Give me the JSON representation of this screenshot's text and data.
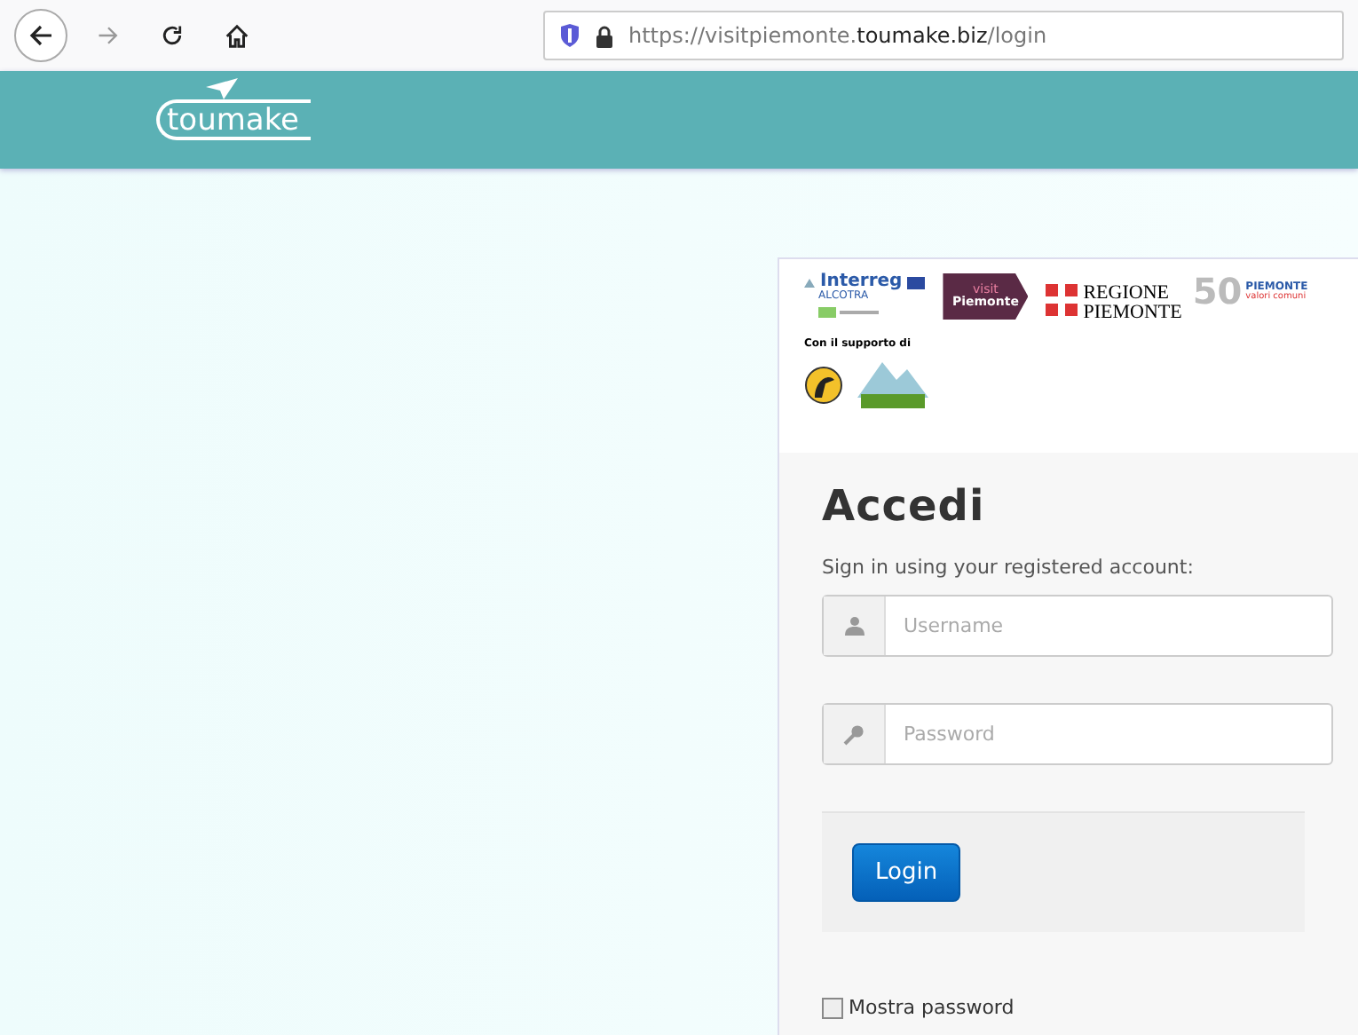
{
  "browser": {
    "url": "https://visitpiemonte.**toumake.biz**/login"
  },
  "header": {
    "logo": "toumake"
  },
  "sponsors": {
    "logos": [
      {
        "kind": "interreg",
        "texts": [
          "Interreg",
          "ALCOTRA"
        ]
      },
      {
        "kind": "visit",
        "texts": [
          "visit",
          "Piemonte"
        ]
      },
      {
        "kind": "regione",
        "texts": [
          "REGIONE",
          "PIEMONTE"
        ]
      },
      {
        "kind": "fifty",
        "texts": [
          "50",
          "PIEMONTE",
          "valori comuni"
        ]
      }
    ],
    "support_label": "Con il supporto di"
  },
  "login": {
    "title": "Accedi",
    "subtitle": "Sign in using your registered account:",
    "fields": [
      {
        "kind": "username",
        "placeholder": "Username"
      },
      {
        "kind": "password",
        "placeholder": "Password"
      }
    ],
    "button": "Login",
    "show_password": {
      "label": "Mostra password",
      "checked": false
    }
  }
}
